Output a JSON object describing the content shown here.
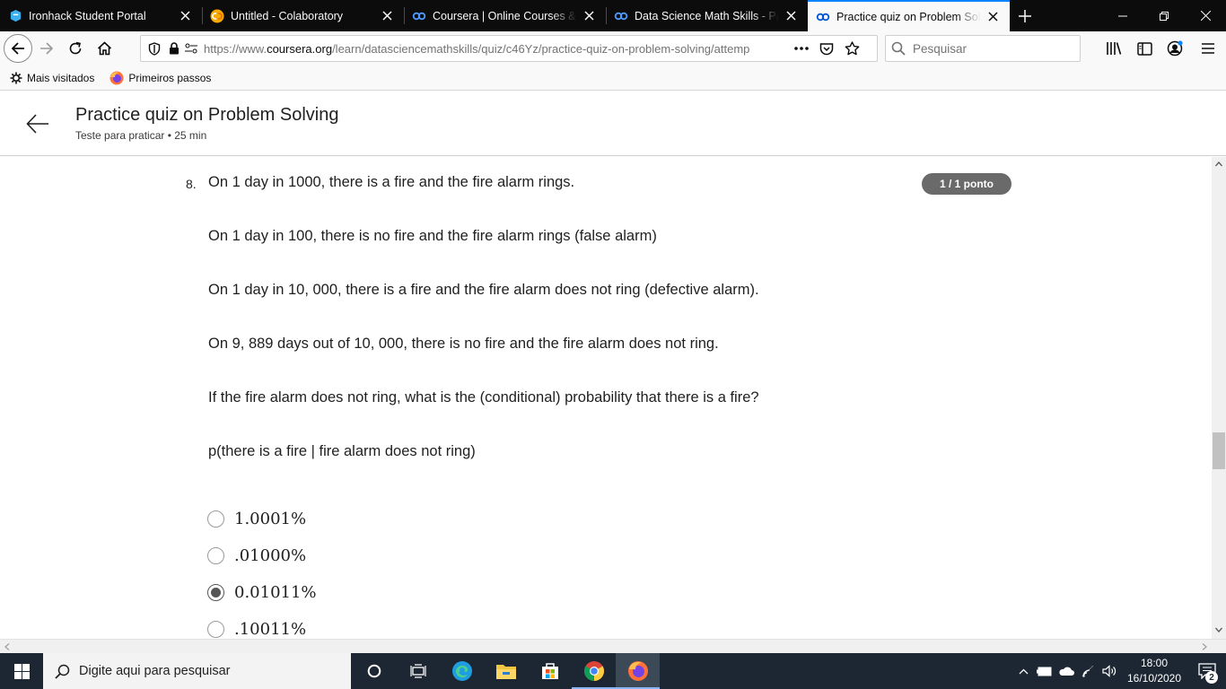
{
  "browser": {
    "tabs": [
      {
        "label": "Ironhack Student Portal",
        "icon": "ironhack-icon",
        "active": false
      },
      {
        "label": "Untitled - Colaboratory",
        "icon": "colab-icon",
        "active": false
      },
      {
        "label": "Coursera | Online Courses & Cr",
        "icon": "coursera-icon",
        "active": false
      },
      {
        "label": "Data Science Math Skills - Págin",
        "icon": "coursera-icon",
        "active": false
      },
      {
        "label": "Practice quiz on Problem Solvin",
        "icon": "coursera-icon",
        "active": true
      }
    ],
    "url": {
      "prefix": "https://www.",
      "domain": "coursera.org",
      "path": "/learn/datasciencemathskills/quiz/c46Yz/practice-quiz-on-problem-solving/attemp"
    },
    "search_placeholder": "Pesquisar",
    "bookmarks": [
      {
        "label": "Mais visitados",
        "icon": "gear-icon"
      },
      {
        "label": "Primeiros passos",
        "icon": "firefox-icon"
      }
    ]
  },
  "page": {
    "title": "Practice quiz on Problem Solving",
    "subtitle": "Teste para praticar • 25 min",
    "question": {
      "number": "8.",
      "score": "1 / 1 ponto",
      "lines": [
        "On 1 day in 1000, there is a fire and the fire alarm rings.",
        "On 1 day in 100, there is no fire and the fire alarm rings (false alarm)",
        "On 1 day in 10, 000, there is a fire and the fire alarm does not ring (defective alarm).",
        "On 9, 889 days out of 10, 000, there is no fire and the fire alarm does not ring.",
        "If the fire alarm does not ring, what is the (conditional) probability that there is a fire?",
        "p(there is a fire | fire alarm does not ring)"
      ],
      "options": [
        {
          "label": "1.0001%",
          "selected": false
        },
        {
          "label": ".01000%",
          "selected": false
        },
        {
          "label": "0.01011%",
          "selected": true
        },
        {
          "label": ".10011%",
          "selected": false
        }
      ]
    }
  },
  "taskbar": {
    "search_placeholder": "Digite aqui para pesquisar",
    "time": "18:00",
    "date": "16/10/2020",
    "notifications": "2"
  }
}
